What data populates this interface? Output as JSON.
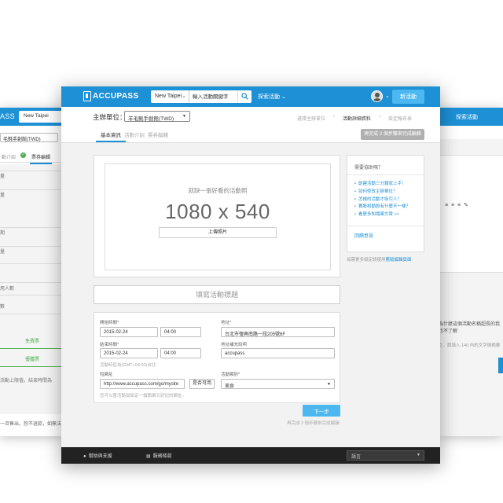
{
  "colors": {
    "brand": "#1d90d6",
    "accent_button": "#4db8f0",
    "success": "#4caf50",
    "footer": "#222222"
  },
  "bg_left": {
    "logo_fragment": "ASS",
    "city": "New Taipei",
    "org_fragment": "毛氈手創館(TWD)",
    "tab_fragment": "動介紹",
    "tab_active": "票券編輯",
    "labels": [
      "量",
      "量",
      "期",
      "量",
      "用人數",
      "數"
    ],
    "green_buttons": [
      "免費票",
      "優體票"
    ],
    "notes": [
      "活動上限值，結束時間為",
      "一旦售出，恕不退款，如無法參"
    ]
  },
  "bg_right": {
    "header_fragment": "探索活動",
    "toolbar": "≡ ≡ ≡  ✎",
    "note_text": "為什麼這個活動名稱超長的我也不了解",
    "hint_text": "之，請填入 140 內的文字做摘要"
  },
  "topbar": {
    "logo": "ACCUPASS",
    "city": "New Taipei",
    "search_placeholder": "輸入活動關鍵字",
    "explore": "探索活動",
    "new_event": "新活動"
  },
  "org": {
    "label": "主辦單位：",
    "value": "羊毛氈手創館(TWD)"
  },
  "steps": [
    "選擇主辦單位",
    "活動詳細資料",
    "設定報名表"
  ],
  "current_step": 1,
  "tabs": [
    "基本資訊",
    "活動介紹",
    "票券編輯"
  ],
  "active_tab": 0,
  "progress_button": "再完成 2 個步驟來完成編輯",
  "image": {
    "prompt": "就缺一張好看的活動照",
    "size": "1080 x 540",
    "upload": "上傳照片"
  },
  "title_placeholder": "填寫活動標題",
  "form": {
    "start_label": "開始時間*",
    "start_date": "2015-02-24",
    "start_time": "04:00",
    "end_label": "結束時間*",
    "end_date": "2015-02-24",
    "end_time": "04:00",
    "timezone_hint": "活動時區為(GMT+08:00)台北",
    "address_label": "地址*",
    "address": "台北市復興南路一段205號6F",
    "address_note_label": "地址補充說明",
    "address_note": "accupass",
    "url_label": "短網址",
    "url": "http://www.accupass.com/go/mysite",
    "check_button": "是否可用",
    "url_hint": "您可以替活動頁設定一個簡單又好記的網址。",
    "category_label": "活動類別*",
    "category": "美食"
  },
  "next_button": "下一步",
  "next_hint": "再完成 2 個步驟來完成編輯",
  "help": {
    "title": "需要協助嗎？",
    "links": [
      "創建活動三分鐘就上手！",
      "如何修改主辦單位？",
      "怎樣的活動才吸引人？",
      "賽股和動股有什麼不一樣？",
      "看更多知識庫文章 >>"
    ],
    "feedback": "回饋意見",
    "legacy_text": "如需更多設定請使用",
    "legacy_link": "舊版編輯頁面"
  },
  "footer": {
    "support": "幫助與支援",
    "terms": "服務條款",
    "language": "語言"
  }
}
